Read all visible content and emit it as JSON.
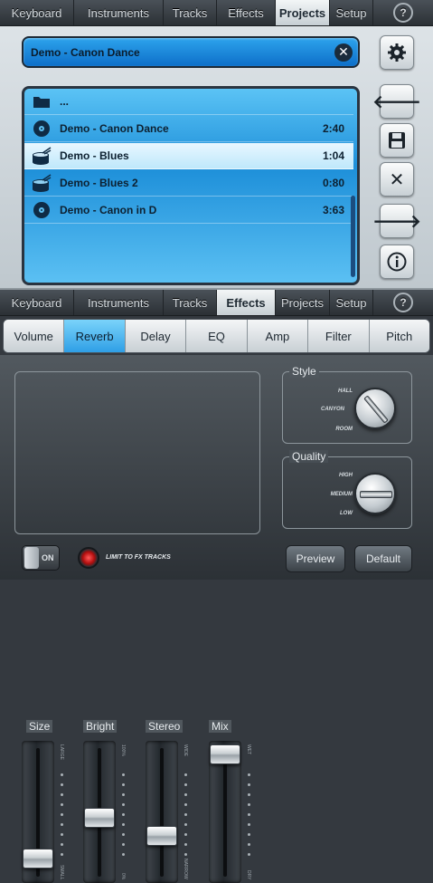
{
  "tabs": [
    "Keyboard",
    "Instruments",
    "Tracks",
    "Effects",
    "Projects",
    "Setup"
  ],
  "help_label": "?",
  "top_active": "Projects",
  "mid_active": "Effects",
  "project_name": "Demo - Canon Dance",
  "clear_label": "✕",
  "list": [
    {
      "name": "...",
      "duration": "",
      "icon": "folder-icon"
    },
    {
      "name": "Demo - Canon Dance",
      "duration": "2:40",
      "icon": "disc-icon"
    },
    {
      "name": "Demo - Blues",
      "duration": "1:04",
      "icon": "drum-icon"
    },
    {
      "name": "Demo - Blues 2",
      "duration": "0:80",
      "icon": "drum-icon"
    },
    {
      "name": "Demo - Canon in D",
      "duration": "3:63",
      "icon": "disc-icon"
    }
  ],
  "side_buttons": [
    "gear-icon",
    "back-arrow-icon",
    "save-icon",
    "delete-icon",
    "forward-arrow-icon",
    "info-icon"
  ],
  "fx_tabs": [
    "Volume",
    "Reverb",
    "Delay",
    "EQ",
    "Amp",
    "Filter",
    "Pitch"
  ],
  "fx_active": "Reverb",
  "sliders": [
    {
      "label": "Size",
      "top": "LARGE",
      "bottom": "SMALL",
      "value": 0.1
    },
    {
      "label": "Bright",
      "top": "100%",
      "bottom": "0%",
      "value": 0.45
    },
    {
      "label": "Stereo",
      "top": "WIDE",
      "bottom": "NARROW",
      "value": 0.3
    },
    {
      "label": "Mix",
      "top": "WET",
      "bottom": "DRY",
      "value": 1.0
    }
  ],
  "style": {
    "label": "Style",
    "options": [
      "HALL",
      "CANYON",
      "ROOM"
    ],
    "selected": "CANYON"
  },
  "quality": {
    "label": "Quality",
    "options": [
      "HIGH",
      "MEDIUM",
      "LOW"
    ],
    "selected": "MEDIUM"
  },
  "toggle_label": "ON",
  "limit_label": "LIMIT TO FX TRACKS",
  "preview_label": "Preview",
  "default_label": "Default",
  "colors": {
    "accent": "#2f9fe6",
    "list_bg": "#1d8fd9",
    "led": "#e02020"
  }
}
